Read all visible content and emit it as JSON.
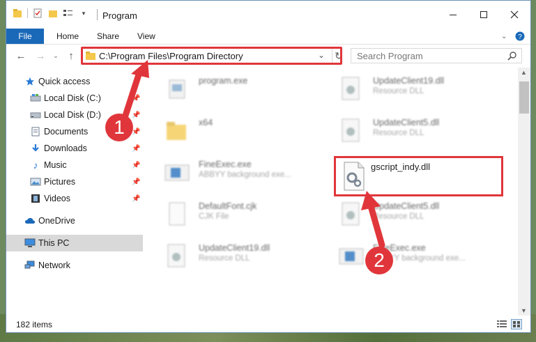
{
  "window": {
    "title": "Program"
  },
  "menu": {
    "file": "File",
    "home": "Home",
    "share": "Share",
    "view": "View"
  },
  "address": {
    "path": "C:\\Program Files\\Program Directory"
  },
  "search": {
    "placeholder": "Search Program"
  },
  "nav": [
    {
      "label": "Quick access",
      "icon": "star-icon",
      "pinned": false
    },
    {
      "label": "Local Disk (C:)",
      "icon": "drive-icon",
      "pinned": true
    },
    {
      "label": "Local Disk (D:)",
      "icon": "drive-icon",
      "pinned": true
    },
    {
      "label": "Documents",
      "icon": "documents-icon",
      "pinned": true
    },
    {
      "label": "Downloads",
      "icon": "downloads-icon",
      "pinned": true
    },
    {
      "label": "Music",
      "icon": "music-icon",
      "pinned": true
    },
    {
      "label": "Pictures",
      "icon": "pictures-icon",
      "pinned": true
    },
    {
      "label": "Videos",
      "icon": "videos-icon",
      "pinned": true
    },
    {
      "label": "OneDrive",
      "icon": "cloud-icon",
      "pinned": false
    },
    {
      "label": "This PC",
      "icon": "pc-icon",
      "pinned": false,
      "selected": true
    },
    {
      "label": "Network",
      "icon": "network-icon",
      "pinned": false
    }
  ],
  "files": [
    {
      "name": "program.exe",
      "desc": "",
      "icon": "exe-icon"
    },
    {
      "name": "UpdateClient19.dll",
      "desc": "Resource DLL",
      "icon": "dll-icon"
    },
    {
      "name": "x64",
      "desc": "",
      "icon": "folder-icon"
    },
    {
      "name": "UpdateClient5.dll",
      "desc": "Resource DLL",
      "icon": "dll-icon"
    },
    {
      "name": "FineExec.exe",
      "desc": "ABBYY background exe...",
      "icon": "app-icon"
    },
    {
      "name": "gscript_indy.dll",
      "desc": "",
      "icon": "dll-icon",
      "highlighted": true
    },
    {
      "name": "DefaultFont.cjk",
      "desc": "CJK File",
      "icon": "file-icon"
    },
    {
      "name": "UpdateClient5.dll",
      "desc": "Resource DLL",
      "icon": "dll-icon"
    },
    {
      "name": "UpdateClient19.dll",
      "desc": "Resource DLL",
      "icon": "dll-icon"
    },
    {
      "name": "FineExec.exe",
      "desc": "ABBYY background exe...",
      "icon": "app-icon"
    }
  ],
  "status": {
    "count": "182 items"
  },
  "markers": {
    "one": "1",
    "two": "2"
  },
  "colors": {
    "accent": "#1a69b9",
    "highlight": "#e0363b"
  }
}
